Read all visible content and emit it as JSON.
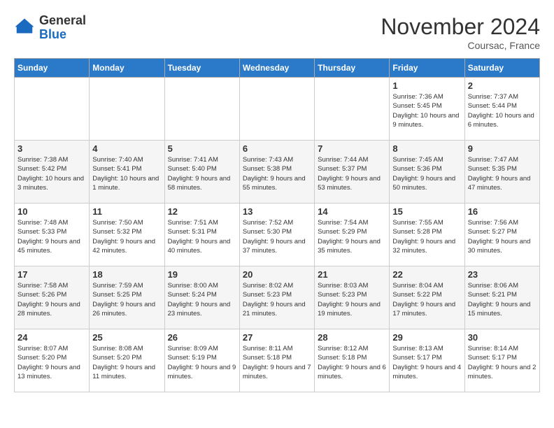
{
  "logo": {
    "general": "General",
    "blue": "Blue"
  },
  "header": {
    "month": "November 2024",
    "location": "Coursac, France"
  },
  "weekdays": [
    "Sunday",
    "Monday",
    "Tuesday",
    "Wednesday",
    "Thursday",
    "Friday",
    "Saturday"
  ],
  "weeks": [
    [
      {
        "day": "",
        "info": ""
      },
      {
        "day": "",
        "info": ""
      },
      {
        "day": "",
        "info": ""
      },
      {
        "day": "",
        "info": ""
      },
      {
        "day": "",
        "info": ""
      },
      {
        "day": "1",
        "info": "Sunrise: 7:36 AM\nSunset: 5:45 PM\nDaylight: 10 hours and 9 minutes."
      },
      {
        "day": "2",
        "info": "Sunrise: 7:37 AM\nSunset: 5:44 PM\nDaylight: 10 hours and 6 minutes."
      }
    ],
    [
      {
        "day": "3",
        "info": "Sunrise: 7:38 AM\nSunset: 5:42 PM\nDaylight: 10 hours and 3 minutes."
      },
      {
        "day": "4",
        "info": "Sunrise: 7:40 AM\nSunset: 5:41 PM\nDaylight: 10 hours and 1 minute."
      },
      {
        "day": "5",
        "info": "Sunrise: 7:41 AM\nSunset: 5:40 PM\nDaylight: 9 hours and 58 minutes."
      },
      {
        "day": "6",
        "info": "Sunrise: 7:43 AM\nSunset: 5:38 PM\nDaylight: 9 hours and 55 minutes."
      },
      {
        "day": "7",
        "info": "Sunrise: 7:44 AM\nSunset: 5:37 PM\nDaylight: 9 hours and 53 minutes."
      },
      {
        "day": "8",
        "info": "Sunrise: 7:45 AM\nSunset: 5:36 PM\nDaylight: 9 hours and 50 minutes."
      },
      {
        "day": "9",
        "info": "Sunrise: 7:47 AM\nSunset: 5:35 PM\nDaylight: 9 hours and 47 minutes."
      }
    ],
    [
      {
        "day": "10",
        "info": "Sunrise: 7:48 AM\nSunset: 5:33 PM\nDaylight: 9 hours and 45 minutes."
      },
      {
        "day": "11",
        "info": "Sunrise: 7:50 AM\nSunset: 5:32 PM\nDaylight: 9 hours and 42 minutes."
      },
      {
        "day": "12",
        "info": "Sunrise: 7:51 AM\nSunset: 5:31 PM\nDaylight: 9 hours and 40 minutes."
      },
      {
        "day": "13",
        "info": "Sunrise: 7:52 AM\nSunset: 5:30 PM\nDaylight: 9 hours and 37 minutes."
      },
      {
        "day": "14",
        "info": "Sunrise: 7:54 AM\nSunset: 5:29 PM\nDaylight: 9 hours and 35 minutes."
      },
      {
        "day": "15",
        "info": "Sunrise: 7:55 AM\nSunset: 5:28 PM\nDaylight: 9 hours and 32 minutes."
      },
      {
        "day": "16",
        "info": "Sunrise: 7:56 AM\nSunset: 5:27 PM\nDaylight: 9 hours and 30 minutes."
      }
    ],
    [
      {
        "day": "17",
        "info": "Sunrise: 7:58 AM\nSunset: 5:26 PM\nDaylight: 9 hours and 28 minutes."
      },
      {
        "day": "18",
        "info": "Sunrise: 7:59 AM\nSunset: 5:25 PM\nDaylight: 9 hours and 26 minutes."
      },
      {
        "day": "19",
        "info": "Sunrise: 8:00 AM\nSunset: 5:24 PM\nDaylight: 9 hours and 23 minutes."
      },
      {
        "day": "20",
        "info": "Sunrise: 8:02 AM\nSunset: 5:23 PM\nDaylight: 9 hours and 21 minutes."
      },
      {
        "day": "21",
        "info": "Sunrise: 8:03 AM\nSunset: 5:23 PM\nDaylight: 9 hours and 19 minutes."
      },
      {
        "day": "22",
        "info": "Sunrise: 8:04 AM\nSunset: 5:22 PM\nDaylight: 9 hours and 17 minutes."
      },
      {
        "day": "23",
        "info": "Sunrise: 8:06 AM\nSunset: 5:21 PM\nDaylight: 9 hours and 15 minutes."
      }
    ],
    [
      {
        "day": "24",
        "info": "Sunrise: 8:07 AM\nSunset: 5:20 PM\nDaylight: 9 hours and 13 minutes."
      },
      {
        "day": "25",
        "info": "Sunrise: 8:08 AM\nSunset: 5:20 PM\nDaylight: 9 hours and 11 minutes."
      },
      {
        "day": "26",
        "info": "Sunrise: 8:09 AM\nSunset: 5:19 PM\nDaylight: 9 hours and 9 minutes."
      },
      {
        "day": "27",
        "info": "Sunrise: 8:11 AM\nSunset: 5:18 PM\nDaylight: 9 hours and 7 minutes."
      },
      {
        "day": "28",
        "info": "Sunrise: 8:12 AM\nSunset: 5:18 PM\nDaylight: 9 hours and 6 minutes."
      },
      {
        "day": "29",
        "info": "Sunrise: 8:13 AM\nSunset: 5:17 PM\nDaylight: 9 hours and 4 minutes."
      },
      {
        "day": "30",
        "info": "Sunrise: 8:14 AM\nSunset: 5:17 PM\nDaylight: 9 hours and 2 minutes."
      }
    ]
  ]
}
